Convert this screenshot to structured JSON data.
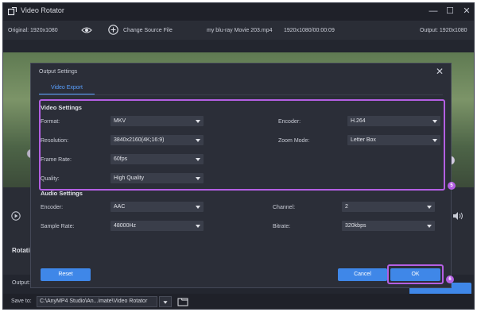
{
  "window": {
    "title": "Video Rotator",
    "minimize": "—",
    "maximize": "☐",
    "close": "✕"
  },
  "infobar": {
    "original": "Original: 1920x1080",
    "change_source": "Change Source File",
    "filename": "my blu-ray Movie 203.mp4",
    "resolution_duration": "1920x1080/00:00:09",
    "output": "Output: 1920x1080"
  },
  "background": {
    "rotation_label": "Rotati",
    "output_label": "Output:",
    "save_to_label": "Save to:",
    "save_path": "C:\\AnyMP4 Studio\\An...imate\\Video Rotator"
  },
  "modal": {
    "title": "Output Settings",
    "close": "✕",
    "tab_video_export": "Video Export",
    "video_settings": {
      "title": "Video Settings",
      "format_label": "Format:",
      "format_value": "MKV",
      "encoder_label": "Encoder:",
      "encoder_value": "H.264",
      "resolution_label": "Resolution:",
      "resolution_value": "3840x2160(4K;16:9)",
      "zoom_label": "Zoom Mode:",
      "zoom_value": "Letter Box",
      "framerate_label": "Frame Rate:",
      "framerate_value": "60fps",
      "quality_label": "Quality:",
      "quality_value": "High Quality"
    },
    "audio_settings": {
      "title": "Audio Settings",
      "encoder_label": "Encoder:",
      "encoder_value": "AAC",
      "channel_label": "Channel:",
      "channel_value": "2",
      "samplerate_label": "Sample Rate:",
      "samplerate_value": "48000Hz",
      "bitrate_label": "Bitrate:",
      "bitrate_value": "320kbps"
    },
    "reset_label": "Reset",
    "cancel_label": "Cancel",
    "ok_label": "OK"
  },
  "annotations": {
    "step5": "5",
    "step6": "6",
    "highlight_color": "#b45fe3"
  },
  "colors": {
    "accent": "#3f87e8",
    "tab_active": "#5aa0ff",
    "panel": "#2b2e38"
  }
}
